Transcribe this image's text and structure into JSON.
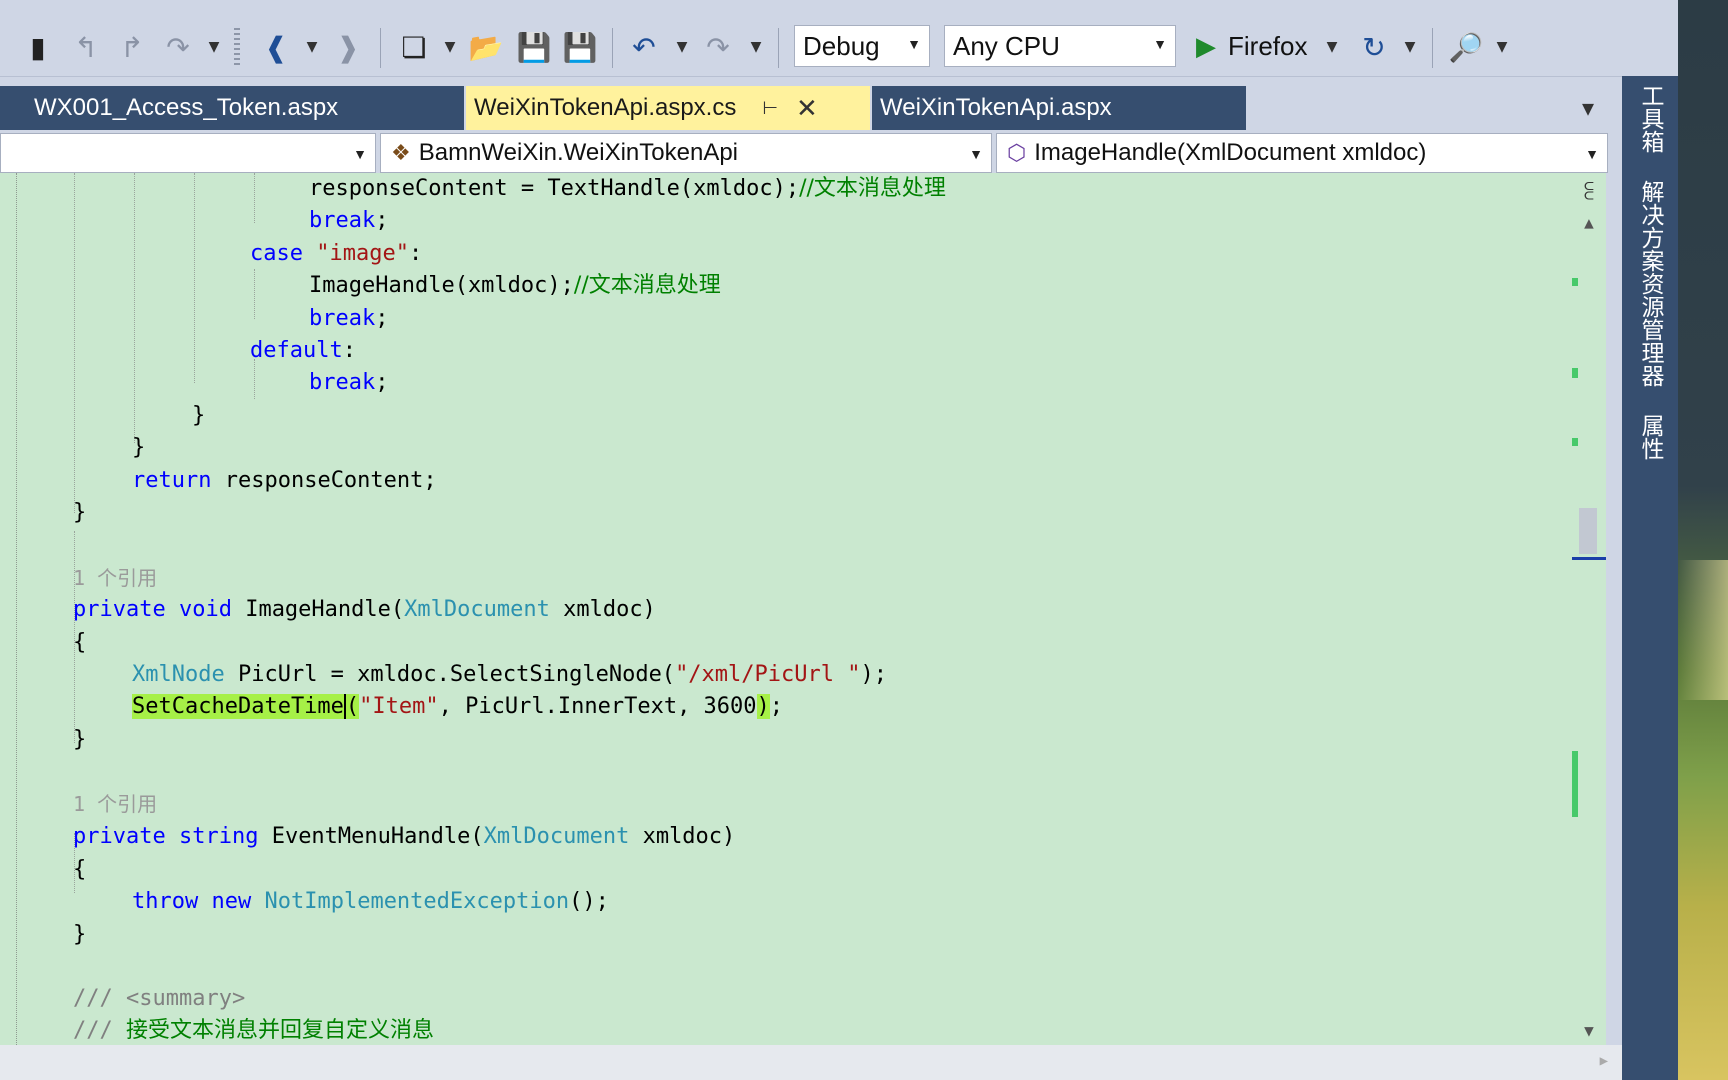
{
  "toolbar": {
    "config_value": "Debug",
    "platform_value": "Any CPU",
    "run_target": "Firefox"
  },
  "tabs": [
    {
      "label": "WX001_Access_Token.aspx",
      "active": false
    },
    {
      "label": "WeiXinTokenApi.aspx.cs",
      "active": true
    },
    {
      "label": "WeiXinTokenApi.aspx",
      "active": false
    }
  ],
  "navbar": {
    "project": "",
    "class": "BamnWeiXin.WeiXinTokenApi",
    "member": "ImageHandle(XmlDocument xmldoc)"
  },
  "code": {
    "l1": {
      "text": "responseContent = TextHandle(xmldoc);",
      "comment": "//文本消息处理"
    },
    "l2": {
      "kw": "break",
      "rest": ";"
    },
    "l3": {
      "kw": "case",
      "str": "\"image\"",
      "rest": ":"
    },
    "l4": {
      "text": "ImageHandle(xmldoc);",
      "comment": "//文本消息处理"
    },
    "l5": {
      "kw": "break",
      "rest": ";"
    },
    "l6": {
      "kw": "default",
      "rest": ":"
    },
    "l7": {
      "kw": "break",
      "rest": ";"
    },
    "l8": "}",
    "l9": "}",
    "l10": {
      "kw": "return",
      "rest": " responseContent;"
    },
    "l11": "}",
    "l12": "1 个引用",
    "l13": {
      "kw1": "private",
      "kw2": "void",
      "name": " ImageHandle(",
      "type": "XmlDocument",
      "rest": " xmldoc)"
    },
    "l14": "{",
    "l15": {
      "type": "XmlNode",
      "mid": " PicUrl = xmldoc.SelectSingleNode(",
      "str": "\"/xml/PicUrl \"",
      "rest": ");"
    },
    "l16": {
      "hl": "SetCacheDateTime",
      "p1": "(",
      "str": "\"Item\"",
      "mid": ", PicUrl.InnerText, 3600",
      "p2": ")",
      "rest": ";"
    },
    "l17": "}",
    "l18": "1 个引用",
    "l19": {
      "kw1": "private",
      "kw2": "string",
      "name": " EventMenuHandle(",
      "type": "XmlDocument",
      "rest": " xmldoc)"
    },
    "l20": "{",
    "l21": {
      "kw1": "throw",
      "kw2": "new",
      "type": "NotImplementedException",
      "rest": "();"
    },
    "l22": "}",
    "l23": {
      "prefix": "/// ",
      "tag": "<summary>"
    },
    "l24": {
      "prefix": "/// ",
      "text": "接受文本消息并回复自定义消息"
    }
  },
  "side_tabs": {
    "toolbox": "工具箱",
    "solution_explorer": "解决方案资源管理器",
    "properties": "属性"
  },
  "colors": {
    "editor_bg": "#cae8cf",
    "keyword": "#0000ff",
    "type": "#2b91af",
    "string": "#a31515",
    "comment": "#008000",
    "active_tab": "#fff29d",
    "inactive_tab": "#364e6f",
    "highlight": "#a6f047"
  }
}
